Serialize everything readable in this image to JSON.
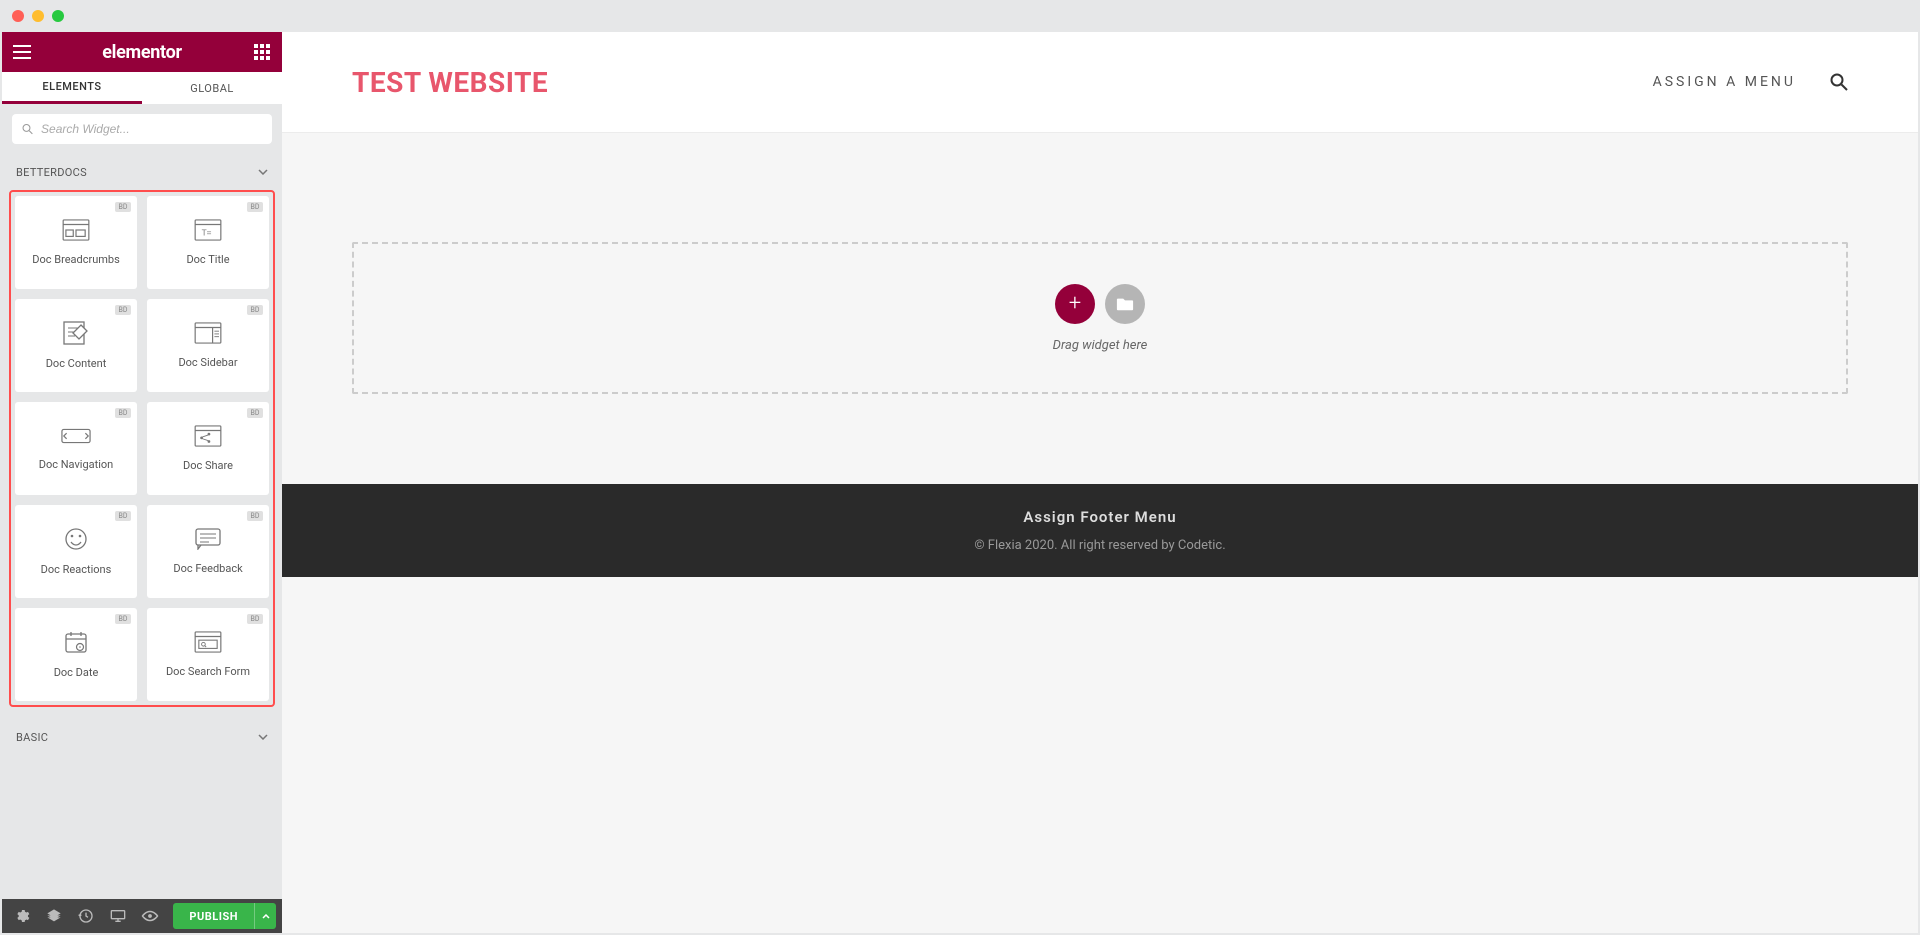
{
  "sidebar": {
    "brand": "elementor",
    "tabs": {
      "elements": "ELEMENTS",
      "global": "GLOBAL"
    },
    "search_placeholder": "Search Widget...",
    "category_betterdocs": "BETTERDOCS",
    "category_basic": "BASIC",
    "widgets": [
      {
        "label": "Doc Breadcrumbs",
        "icon": "breadcrumbs"
      },
      {
        "label": "Doc Title",
        "icon": "title"
      },
      {
        "label": "Doc Content",
        "icon": "content"
      },
      {
        "label": "Doc Sidebar",
        "icon": "sidebar"
      },
      {
        "label": "Doc Navigation",
        "icon": "navigation"
      },
      {
        "label": "Doc Share",
        "icon": "share"
      },
      {
        "label": "Doc Reactions",
        "icon": "reactions"
      },
      {
        "label": "Doc Feedback",
        "icon": "feedback"
      },
      {
        "label": "Doc Date",
        "icon": "date"
      },
      {
        "label": "Doc Search Form",
        "icon": "search-form"
      }
    ],
    "badge_text": "BD",
    "publish_label": "PUBLISH"
  },
  "canvas": {
    "site_title": "TEST WEBSITE",
    "assign_menu": "ASSIGN A MENU",
    "drop_hint": "Drag widget here",
    "footer_title": "Assign Footer Menu",
    "footer_copy": "© Flexia 2020. All right reserved by Codetic."
  }
}
